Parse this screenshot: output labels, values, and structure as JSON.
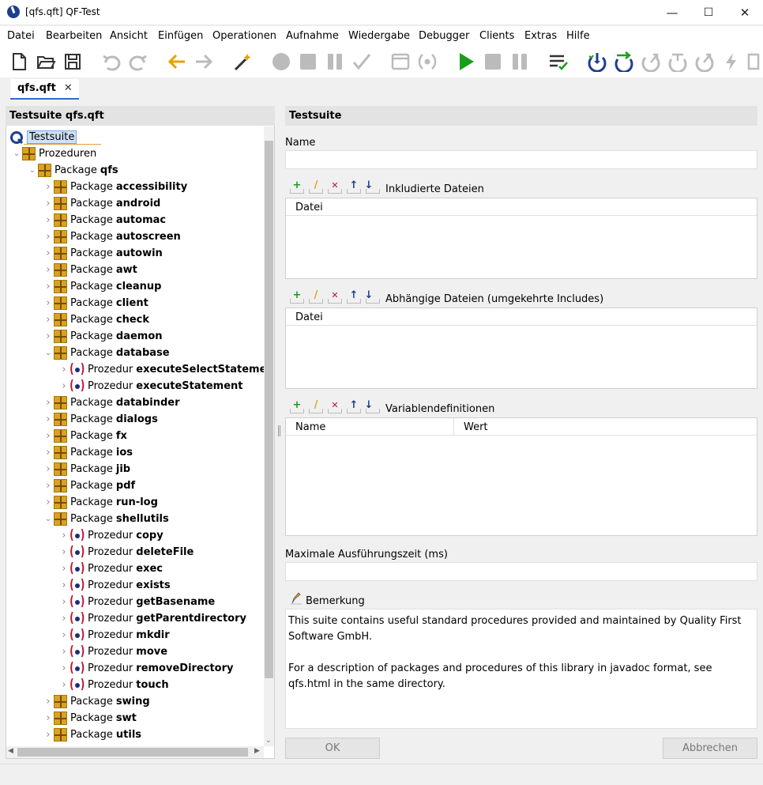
{
  "window": {
    "title": "[qfs.qft] QF-Test",
    "minimize": "—",
    "maximize": "☐",
    "close": "✕"
  },
  "menu": [
    "Datei",
    "Bearbeiten",
    "Ansicht",
    "Einfügen",
    "Operationen",
    "Aufnahme",
    "Wiedergabe",
    "Debugger",
    "Clients",
    "Extras",
    "Hilfe"
  ],
  "toolbar_icons": [
    "new-file-icon",
    "open-folder-icon",
    "save-icon",
    "undo-icon",
    "redo-icon",
    "back-arrow-icon",
    "forward-arrow-icon",
    "wand-icon",
    "record-icon",
    "stop-record-icon",
    "pause-record-icon",
    "check-icon",
    "component-window-icon",
    "procedure-record-icon",
    "play-icon",
    "stop-icon",
    "pause-icon",
    "list-check-icon",
    "step-in-icon",
    "step-over-icon",
    "step-out-icon",
    "continue-icon",
    "skip-icon",
    "lightning-icon",
    "breakpoint-icon"
  ],
  "tab": {
    "label": "qfs.qft",
    "close": "✕"
  },
  "tree": {
    "header": "Testsuite qfs.qft",
    "root_label": "Testsuite",
    "items": [
      {
        "depth": 0,
        "type": "pkg",
        "expanded": true,
        "prefix": "Prozeduren",
        "name": ""
      },
      {
        "depth": 1,
        "type": "pkg",
        "expanded": true,
        "prefix": "Package",
        "name": "qfs"
      },
      {
        "depth": 2,
        "type": "pkg",
        "expanded": false,
        "prefix": "Package",
        "name": "accessibility"
      },
      {
        "depth": 2,
        "type": "pkg",
        "expanded": false,
        "prefix": "Package",
        "name": "android"
      },
      {
        "depth": 2,
        "type": "pkg",
        "expanded": false,
        "prefix": "Package",
        "name": "automac"
      },
      {
        "depth": 2,
        "type": "pkg",
        "expanded": false,
        "prefix": "Package",
        "name": "autoscreen"
      },
      {
        "depth": 2,
        "type": "pkg",
        "expanded": false,
        "prefix": "Package",
        "name": "autowin"
      },
      {
        "depth": 2,
        "type": "pkg",
        "expanded": false,
        "prefix": "Package",
        "name": "awt"
      },
      {
        "depth": 2,
        "type": "pkg",
        "expanded": false,
        "prefix": "Package",
        "name": "cleanup"
      },
      {
        "depth": 2,
        "type": "pkg",
        "expanded": false,
        "prefix": "Package",
        "name": "client"
      },
      {
        "depth": 2,
        "type": "pkg",
        "expanded": false,
        "prefix": "Package",
        "name": "check"
      },
      {
        "depth": 2,
        "type": "pkg",
        "expanded": false,
        "prefix": "Package",
        "name": "daemon"
      },
      {
        "depth": 2,
        "type": "pkg",
        "expanded": true,
        "prefix": "Package",
        "name": "database"
      },
      {
        "depth": 3,
        "type": "proc",
        "expanded": false,
        "prefix": "Prozedur",
        "name": "executeSelectStatement"
      },
      {
        "depth": 3,
        "type": "proc",
        "expanded": false,
        "prefix": "Prozedur",
        "name": "executeStatement"
      },
      {
        "depth": 2,
        "type": "pkg",
        "expanded": false,
        "prefix": "Package",
        "name": "databinder"
      },
      {
        "depth": 2,
        "type": "pkg",
        "expanded": false,
        "prefix": "Package",
        "name": "dialogs"
      },
      {
        "depth": 2,
        "type": "pkg",
        "expanded": false,
        "prefix": "Package",
        "name": "fx"
      },
      {
        "depth": 2,
        "type": "pkg",
        "expanded": false,
        "prefix": "Package",
        "name": "ios"
      },
      {
        "depth": 2,
        "type": "pkg",
        "expanded": false,
        "prefix": "Package",
        "name": "jib"
      },
      {
        "depth": 2,
        "type": "pkg",
        "expanded": false,
        "prefix": "Package",
        "name": "pdf"
      },
      {
        "depth": 2,
        "type": "pkg",
        "expanded": false,
        "prefix": "Package",
        "name": "run-log"
      },
      {
        "depth": 2,
        "type": "pkg",
        "expanded": true,
        "prefix": "Package",
        "name": "shellutils"
      },
      {
        "depth": 3,
        "type": "proc",
        "expanded": false,
        "prefix": "Prozedur",
        "name": "copy"
      },
      {
        "depth": 3,
        "type": "proc",
        "expanded": false,
        "prefix": "Prozedur",
        "name": "deleteFile"
      },
      {
        "depth": 3,
        "type": "proc",
        "expanded": false,
        "prefix": "Prozedur",
        "name": "exec"
      },
      {
        "depth": 3,
        "type": "proc",
        "expanded": false,
        "prefix": "Prozedur",
        "name": "exists"
      },
      {
        "depth": 3,
        "type": "proc",
        "expanded": false,
        "prefix": "Prozedur",
        "name": "getBasename"
      },
      {
        "depth": 3,
        "type": "proc",
        "expanded": false,
        "prefix": "Prozedur",
        "name": "getParentdirectory"
      },
      {
        "depth": 3,
        "type": "proc",
        "expanded": false,
        "prefix": "Prozedur",
        "name": "mkdir"
      },
      {
        "depth": 3,
        "type": "proc",
        "expanded": false,
        "prefix": "Prozedur",
        "name": "move"
      },
      {
        "depth": 3,
        "type": "proc",
        "expanded": false,
        "prefix": "Prozedur",
        "name": "removeDirectory"
      },
      {
        "depth": 3,
        "type": "proc",
        "expanded": false,
        "prefix": "Prozedur",
        "name": "touch"
      },
      {
        "depth": 2,
        "type": "pkg",
        "expanded": false,
        "prefix": "Package",
        "name": "swing"
      },
      {
        "depth": 2,
        "type": "pkg",
        "expanded": false,
        "prefix": "Package",
        "name": "swt"
      },
      {
        "depth": 2,
        "type": "pkg",
        "expanded": false,
        "prefix": "Package",
        "name": "utils"
      }
    ]
  },
  "details": {
    "header": "Testsuite",
    "name_label": "Name",
    "name_value": "",
    "included_label": "Inkludierte Dateien",
    "included_col": "Datei",
    "dependent_label": "Abhängige Dateien (umgekehrte Includes)",
    "dependent_col": "Datei",
    "vars_label": "Variablendefinitionen",
    "vars_col_name": "Name",
    "vars_col_value": "Wert",
    "maxtime_label": "Maximale Ausführungszeit (ms)",
    "maxtime_value": "",
    "comment_label": "Bemerkung",
    "comment_p1": "This suite contains useful standard procedures provided and maintained by Quality First Software GmbH.",
    "comment_p2": "For a description of packages and procedures of this library in javadoc format, see qfs.html in the same directory.",
    "ok": "OK",
    "cancel": "Abbrechen"
  },
  "mini_toolbar_icons": [
    "add-icon",
    "edit-icon",
    "delete-icon",
    "move-up-icon",
    "move-down-icon"
  ],
  "colors": {
    "accent": "#2a6fd1",
    "package": "#d9a321",
    "procedure": "#c2152c",
    "play": "#1a9e1a"
  }
}
